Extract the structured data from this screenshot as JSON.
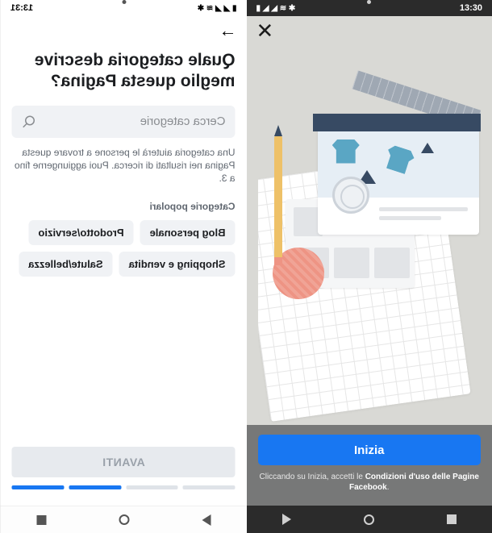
{
  "left": {
    "status_time": "13:31",
    "arrow_icon": "arrow-right",
    "heading": "Quale categoria descrive meglio questa Pagina?",
    "search_placeholder": "Cerca categorie",
    "help_text": "Una categoria aiuterà le persone a trovare questa Pagina nei risultati di ricerca. Puoi aggiungerne fino a 3.",
    "subheading": "Categorie popolari",
    "categories": [
      "Blog personale",
      "Prodotto/servizio",
      "Shopping e vendita",
      "Salute/bellezza"
    ],
    "next_btn": "AVANTI",
    "progress_total": 4,
    "progress_active": [
      2,
      3
    ]
  },
  "right": {
    "status_time": "13:30",
    "close_icon": "close-x",
    "start_btn": "Inizia",
    "disclaimer_pre": "Cliccando su Inizia, accetti le ",
    "disclaimer_link": "Condizioni d'uso delle Pagine Facebook",
    "disclaimer_post": "."
  }
}
